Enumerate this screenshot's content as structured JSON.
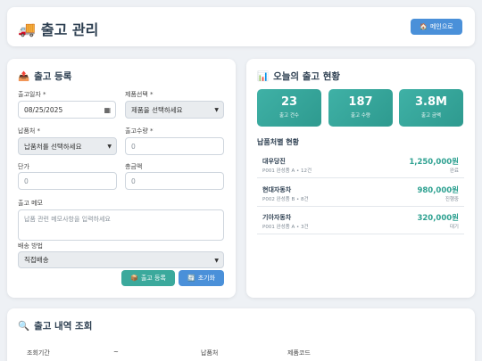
{
  "header": {
    "icon": "truck-icon",
    "title": "출고 관리",
    "home_label": "메인으로"
  },
  "form": {
    "title": "출고 등록",
    "fields": {
      "date": {
        "label": "출고일자 *",
        "value": "08/25/2025"
      },
      "product": {
        "label": "제품선택 *",
        "value": "제품을 선택하세요"
      },
      "customer": {
        "label": "납품처 *",
        "value": "납품처를 선택하세요"
      },
      "quantity": {
        "label": "출고수량 *",
        "placeholder": "0"
      },
      "unit_price": {
        "label": "단가",
        "placeholder": "0"
      },
      "total": {
        "label": "총금액",
        "placeholder": "0"
      },
      "memo": {
        "label": "출고 메모",
        "placeholder": "납품 관련 메모사항을 입력하세요"
      },
      "delivery": {
        "label": "배송 방법",
        "value": "직접배송"
      }
    },
    "register_label": "출고 등록",
    "reset_label": "초기화"
  },
  "status": {
    "title": "오늘의 출고 현황",
    "stats": [
      {
        "value": "23",
        "label": "출고 건수"
      },
      {
        "value": "187",
        "label": "출고 수량"
      },
      {
        "value": "3.8M",
        "label": "출고 금액"
      }
    ],
    "sub_title": "납품처별 현황",
    "rows": [
      {
        "name": "대우당진",
        "detail": "P001 완성품 A • 12건",
        "amount": "1,250,000원",
        "state": "완료"
      },
      {
        "name": "현대자동차",
        "detail": "P002 완성품 B • 8건",
        "amount": "980,000원",
        "state": "진행중"
      },
      {
        "name": "기아자동차",
        "detail": "P001 완성품 A • 3건",
        "amount": "320,000원",
        "state": "대기"
      }
    ]
  },
  "search": {
    "title": "출고 내역 조회",
    "period_label": "조회기간",
    "tilde": "~",
    "customer_label": "납품처",
    "product_code_label": "제품코드"
  },
  "colors": {
    "primary": "#4a90d9",
    "teal": "#3ba99c"
  }
}
